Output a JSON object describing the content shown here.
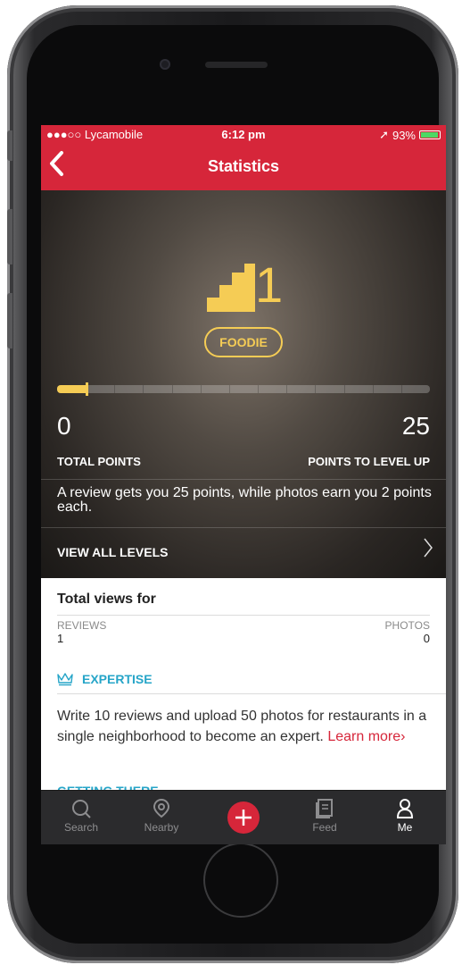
{
  "statusbar": {
    "carrier": "●●●○○ Lycamobile",
    "time": "6:12 pm",
    "battery": "93%"
  },
  "navbar": {
    "title": "Statistics"
  },
  "level": {
    "number": "1",
    "name": "FOODIE",
    "progress": 0.08
  },
  "points": {
    "total": "0",
    "total_label": "TOTAL POINTS",
    "to_level_up": "25",
    "to_level_up_label": "POINTS TO LEVEL UP",
    "description": "A review gets you 25 points, while photos earn you 2 points each.",
    "view_all_label": "VIEW ALL LEVELS"
  },
  "views": {
    "title": "Total views for",
    "reviews_label": "REVIEWS",
    "reviews_value": "1",
    "photos_label": "PHOTOS",
    "photos_value": "0"
  },
  "expertise": {
    "title": "EXPERTISE",
    "text": "Write 10 reviews and upload 50 photos for restaurants in a single neighborhood to become an expert.",
    "learn_more": "Learn more",
    "next_section": "GETTING THERE"
  },
  "tabs": [
    {
      "label": "Search",
      "icon": "search-icon"
    },
    {
      "label": "Nearby",
      "icon": "location-pin-icon"
    },
    {
      "label": "",
      "icon": "plus-icon"
    },
    {
      "label": "Feed",
      "icon": "feed-icon"
    },
    {
      "label": "Me",
      "icon": "person-icon"
    }
  ],
  "colors": {
    "brand_red": "#d6263a",
    "gold": "#f5cc55",
    "accent_blue": "#26a5c8"
  }
}
